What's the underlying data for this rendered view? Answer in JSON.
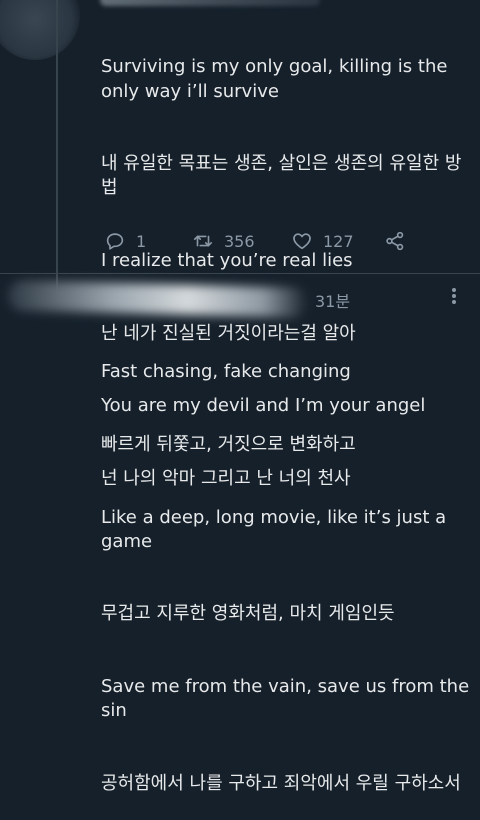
{
  "tweet1": {
    "lines": [
      "Surviving is my only goal, killing is the only way i’ll survive",
      "내 유일한 목표는 생존, 살인은 생존의 유일한 방법",
      "I realize that you’re real lies",
      "난 네가 진실된 거짓이라는걸 알아",
      "You are my devil and I’m your angel",
      "넌 나의 악마 그리고 난 너의 천사"
    ],
    "replies": "1",
    "retweets": "356",
    "likes": "127"
  },
  "tweet2": {
    "time": "31분",
    "lines": [
      "Fast chasing, fake changing",
      "빠르게 뒤쫓고, 거짓으로 변화하고",
      "Like a deep, long movie, like it’s just a game",
      "무겁고 지루한 영화처럼, 마치 게임인듯",
      "Save me from the vain, save us from the sin",
      "공허함에서 나를 구하고 죄악에서 우릴 구하소서"
    ]
  },
  "colors": {
    "background": "#15202b",
    "text": "#e7e9ea",
    "muted": "#8b98a5",
    "divider": "#38444d"
  }
}
